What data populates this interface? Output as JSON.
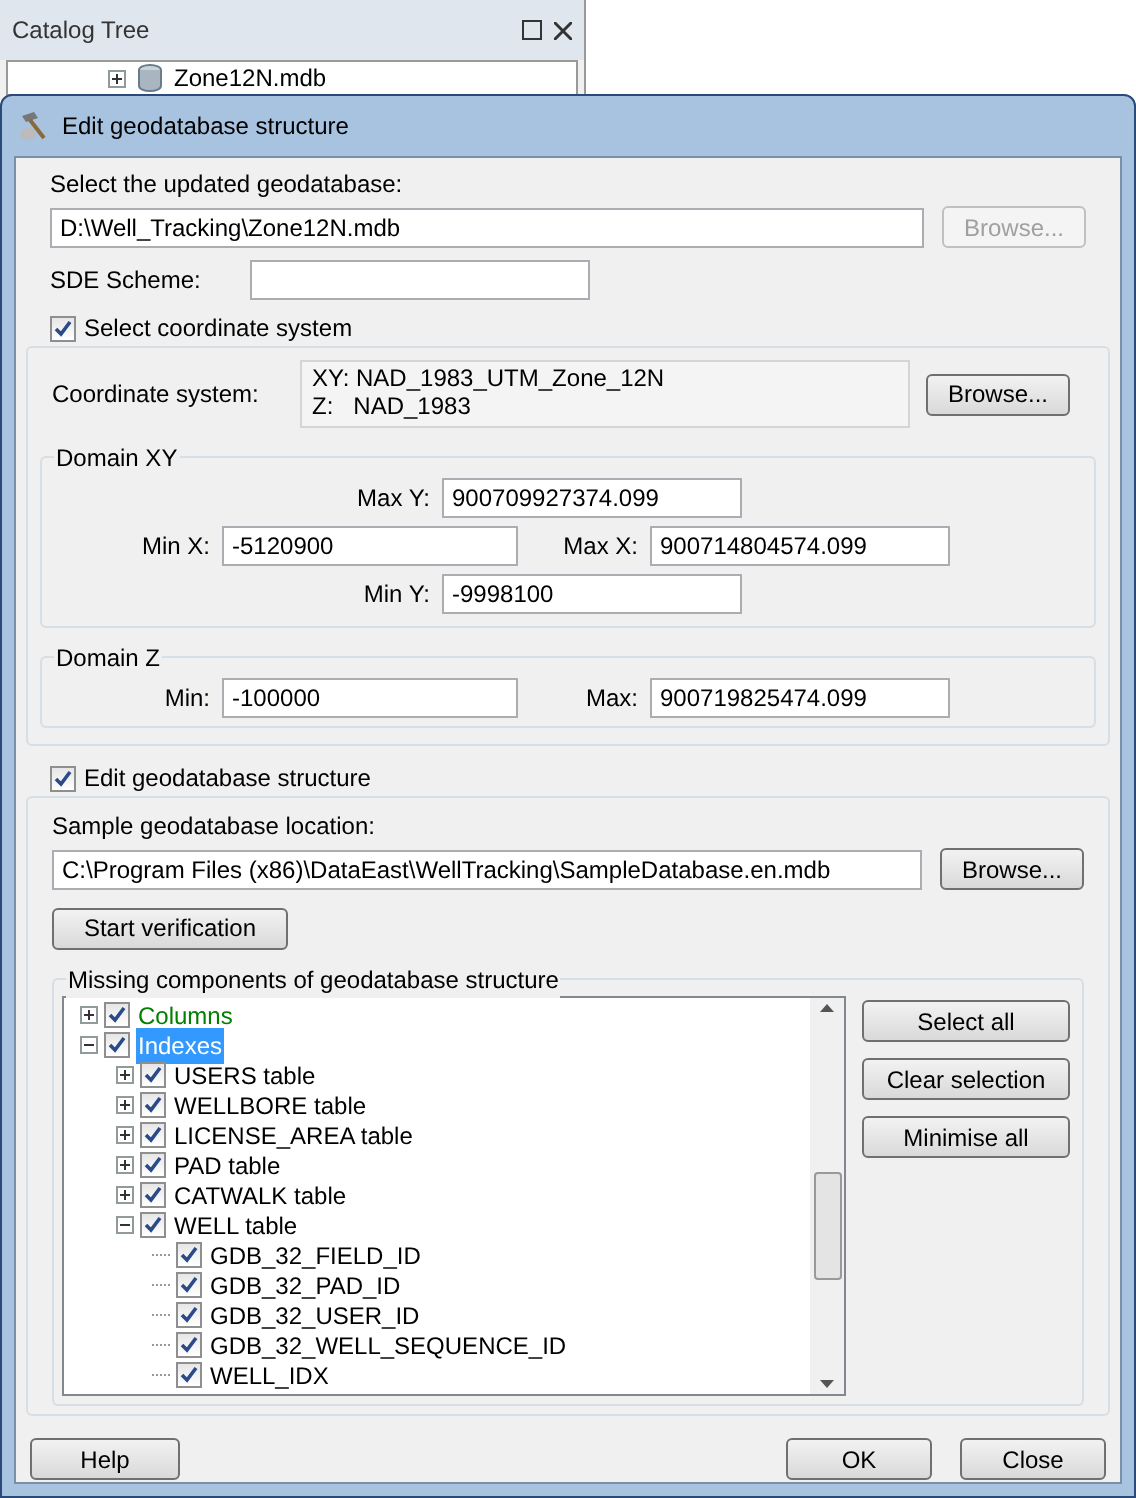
{
  "catalog_tree": {
    "title": "Catalog Tree",
    "item": {
      "label": "Zone12N.mdb",
      "expanded": false
    }
  },
  "dialog": {
    "title": "Edit geodatabase structure",
    "geodatabase": {
      "label": "Select the updated geodatabase:",
      "value": "D:\\Well_Tracking\\Zone12N.mdb",
      "browse": {
        "label": "Browse...",
        "disabled": true
      }
    },
    "sde_scheme": {
      "label": "SDE Scheme:"
    },
    "coordinate_group": {
      "label": "Select coordinate system",
      "checked": true,
      "coordinate_system": {
        "label": "Coordinate system:",
        "lines": [
          "XY: NAD_1983_UTM_Zone_12N",
          "Z:   NAD_1983"
        ],
        "browse": {
          "label": "Browse...",
          "disabled": false
        }
      },
      "domain_xy": {
        "title": "Domain XY",
        "max_y": {
          "label": "Max Y:",
          "value": "900709927374.099"
        },
        "min_x": {
          "label": "Min X:",
          "value": "-5120900"
        },
        "max_x": {
          "label": "Max X:",
          "value": "900714804574.099"
        },
        "min_y": {
          "label": "Min Y:",
          "value": "-9998100"
        }
      },
      "domain_z": {
        "title": "Domain Z",
        "min": {
          "label": "Min:",
          "value": "-100000"
        },
        "max": {
          "label": "Max:",
          "value": "900719825474.099"
        }
      }
    },
    "structure_group": {
      "label": "Edit geodatabase structure",
      "checked": true,
      "sample_location": {
        "label": "Sample geodatabase location:",
        "value": "C:\\Program Files (x86)\\DataEast\\WellTracking\\SampleDatabase.en.mdb",
        "browse": {
          "label": "Browse...",
          "disabled": false
        }
      },
      "start_verification": "Start verification",
      "missing": {
        "title": "Missing components of geodatabase structure",
        "tree": [
          {
            "label": "Columns",
            "checked": true,
            "expanded": false,
            "selected": false,
            "color": "#008000"
          },
          {
            "label": "Indexes",
            "checked": true,
            "expanded": true,
            "selected": true,
            "children": [
              {
                "label": "USERS table",
                "checked": true,
                "expanded": false,
                "selected": false
              },
              {
                "label": "WELLBORE table",
                "checked": true,
                "expanded": false,
                "selected": false
              },
              {
                "label": "LICENSE_AREA table",
                "checked": true,
                "expanded": false,
                "selected": false
              },
              {
                "label": "PAD table",
                "checked": true,
                "expanded": false,
                "selected": false
              },
              {
                "label": "CATWALK table",
                "checked": true,
                "expanded": false,
                "selected": false
              },
              {
                "label": "WELL table",
                "checked": true,
                "expanded": true,
                "selected": false,
                "children": [
                  {
                    "label": "GDB_32_FIELD_ID",
                    "checked": true,
                    "selected": false
                  },
                  {
                    "label": "GDB_32_PAD_ID",
                    "checked": true,
                    "selected": false
                  },
                  {
                    "label": "GDB_32_USER_ID",
                    "checked": true,
                    "selected": false
                  },
                  {
                    "label": "GDB_32_WELL_SEQUENCE_ID",
                    "checked": true,
                    "selected": false
                  },
                  {
                    "label": "WELL_IDX",
                    "checked": true,
                    "selected": false
                  }
                ]
              }
            ]
          }
        ],
        "buttons": [
          "Select all",
          "Clear selection",
          "Minimise all"
        ]
      }
    },
    "footer": {
      "help": "Help",
      "ok": "OK",
      "close": "Close"
    }
  }
}
